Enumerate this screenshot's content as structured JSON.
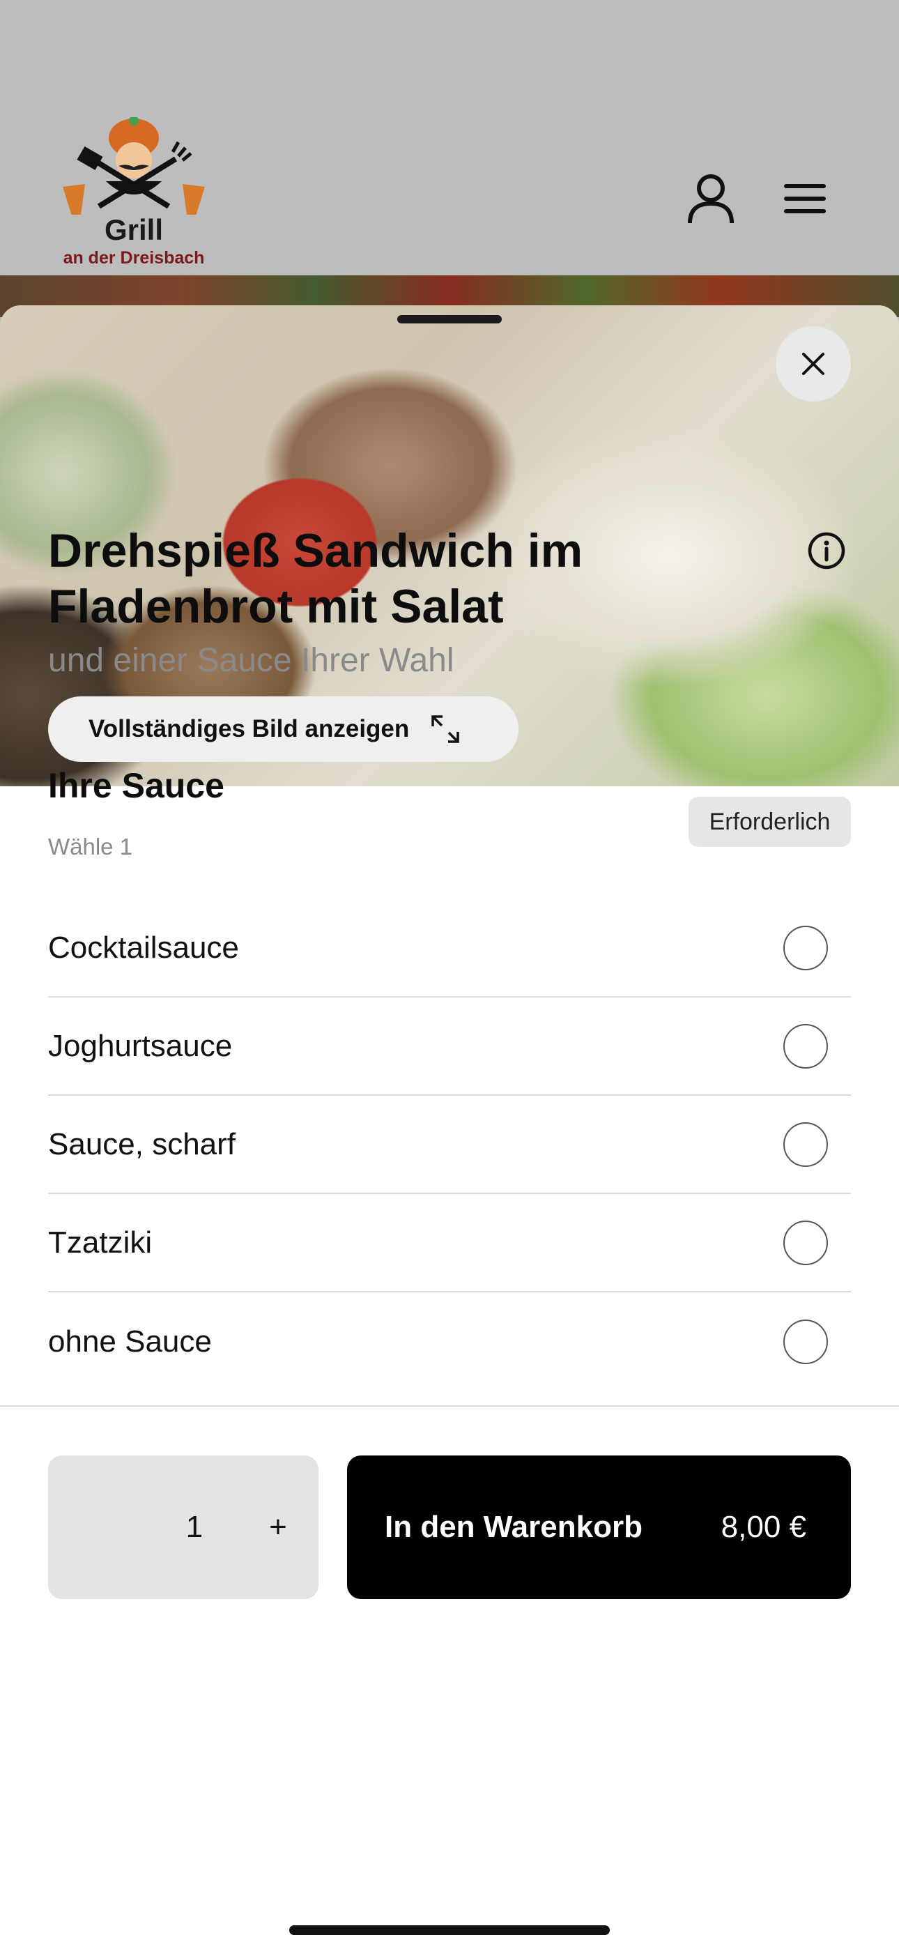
{
  "header": {
    "logo_title": "Grill",
    "logo_subtitle": "an der Dreisbach"
  },
  "hero": {
    "full_image_label": "Vollständiges Bild anzeigen"
  },
  "product": {
    "title": "Drehspieß Sandwich im Fladenbrot mit Salat",
    "subtitle": "und einer Sauce Ihrer Wahl"
  },
  "option_group": {
    "title": "Ihre Sauce",
    "choose_hint": "Wähle 1",
    "required_badge": "Erforderlich",
    "options": [
      {
        "label": "Cocktailsauce"
      },
      {
        "label": "Joghurtsauce"
      },
      {
        "label": "Sauce, scharf"
      },
      {
        "label": "Tzatziki"
      },
      {
        "label": "ohne Sauce"
      }
    ]
  },
  "footer": {
    "quantity": "1",
    "plus": "+",
    "cart_label": "In den Warenkorb",
    "price": "8,00 €"
  },
  "colors": {
    "header_bg": "#bdbdbd",
    "cart_button": "#000000",
    "stepper_bg": "#e3e3e3",
    "subtitle_text": "#8a8a8a"
  },
  "icons": [
    "user-icon",
    "menu-icon",
    "close-icon",
    "expand-icon",
    "info-icon"
  ]
}
